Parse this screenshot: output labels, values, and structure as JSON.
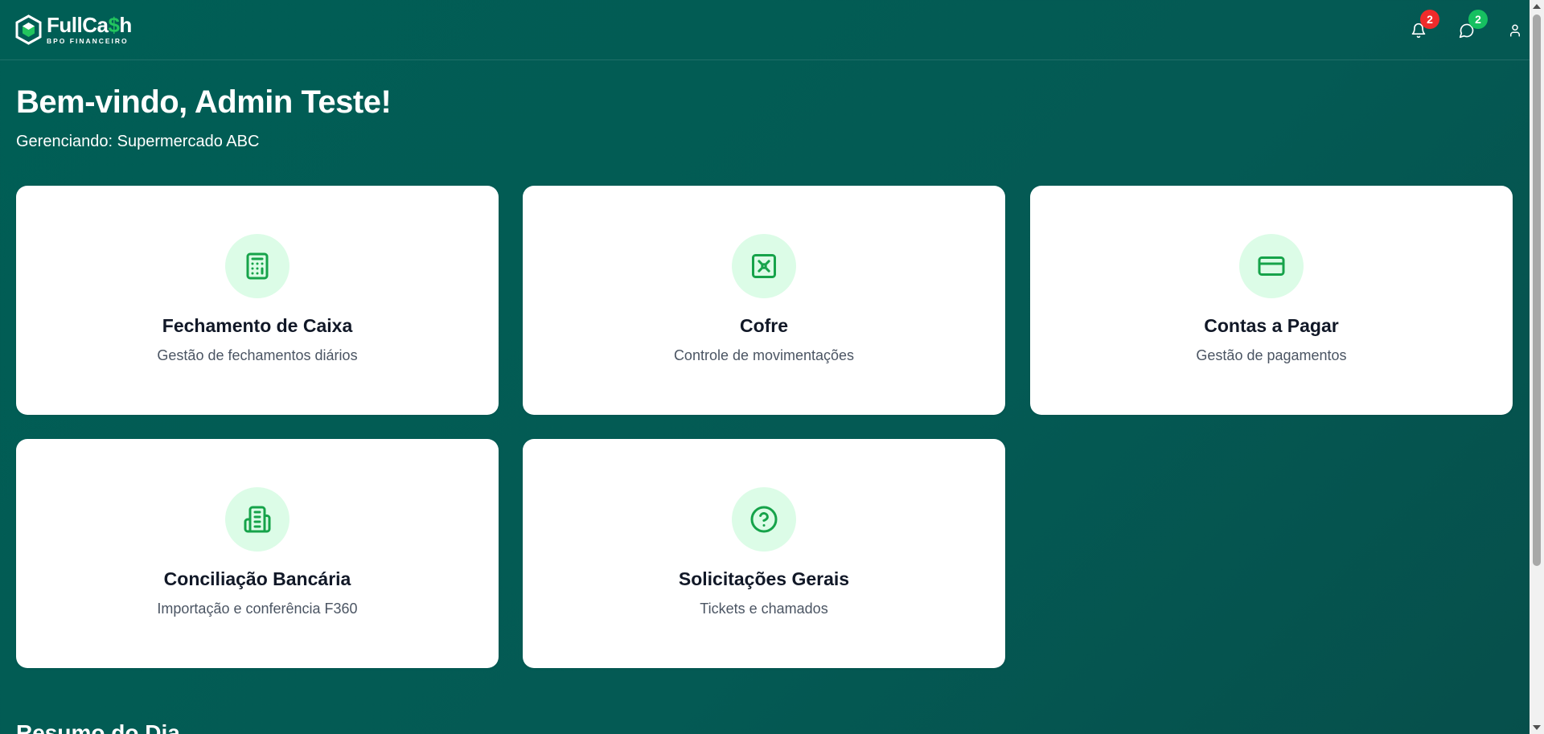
{
  "brand": {
    "name_part1": "FullCa",
    "name_accent": "$",
    "name_part2": "h",
    "subtitle": "BPO FINANCEIRO",
    "accent_color": "#22c55e"
  },
  "header": {
    "notifications": {
      "icon": "bell-icon",
      "count": "2",
      "badge_color": "#ef2b2b"
    },
    "messages": {
      "icon": "chat-icon",
      "count": "2",
      "badge_color": "#16c060"
    },
    "profile": {
      "icon": "user-icon"
    }
  },
  "welcome": {
    "title": "Bem-vindo, Admin Teste!",
    "subtitle": "Gerenciando: Supermercado ABC"
  },
  "modules": [
    {
      "title": "Fechamento de Caixa",
      "description": "Gestão de fechamentos diários",
      "icon": "calculator-icon"
    },
    {
      "title": "Cofre",
      "description": "Controle de movimentações",
      "icon": "vault-icon"
    },
    {
      "title": "Contas a Pagar",
      "description": "Gestão de pagamentos",
      "icon": "credit-card-icon"
    },
    {
      "title": "Conciliação Bancária",
      "description": "Importação e conferência F360",
      "icon": "building-icon"
    },
    {
      "title": "Solicitações Gerais",
      "description": "Tickets e chamados",
      "icon": "help-circle-icon"
    }
  ],
  "summary": {
    "title": "Resumo do Dia"
  },
  "colors": {
    "background": "#005e55",
    "card": "#ffffff",
    "icon_bg": "#dcfce7",
    "icon_stroke": "#16a34a"
  }
}
